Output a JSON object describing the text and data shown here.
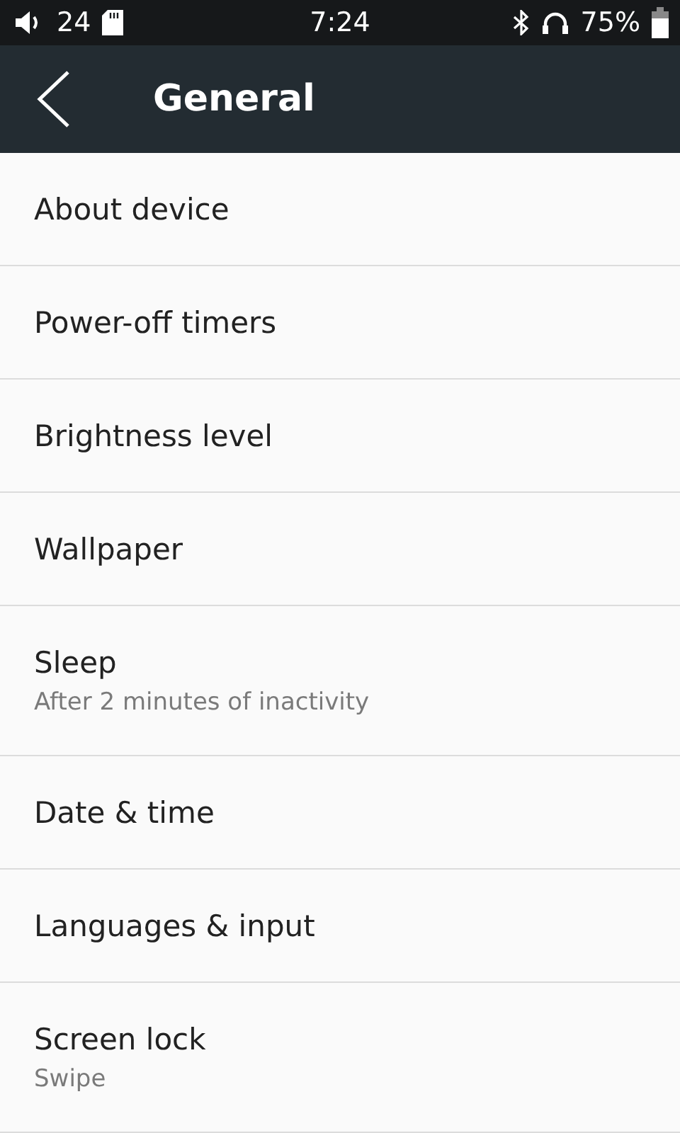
{
  "status_bar": {
    "volume": "24",
    "time": "7:24",
    "battery": "75%"
  },
  "header": {
    "title": "General"
  },
  "items": [
    {
      "title": "About device"
    },
    {
      "title": "Power-off timers"
    },
    {
      "title": "Brightness level"
    },
    {
      "title": "Wallpaper"
    },
    {
      "title": "Sleep",
      "subtitle": "After 2 minutes of inactivity"
    },
    {
      "title": "Date & time"
    },
    {
      "title": "Languages & input"
    },
    {
      "title": "Screen lock",
      "subtitle": "Swipe"
    }
  ]
}
